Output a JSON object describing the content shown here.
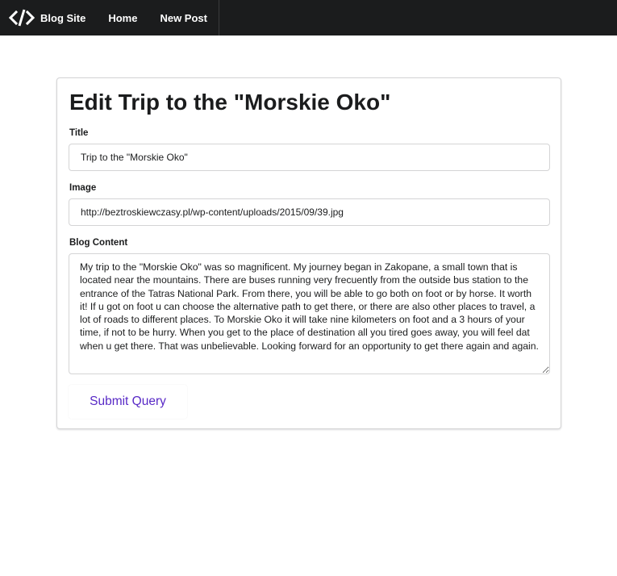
{
  "nav": {
    "brand_icon": "code-icon",
    "brand": "Blog Site",
    "home": "Home",
    "new_post": "New Post"
  },
  "page": {
    "title": "Edit Trip to the \"Morskie Oko\""
  },
  "form": {
    "title_label": "Title",
    "title_value": "Trip to the \"Morskie Oko\"",
    "image_label": "Image",
    "image_value": "http://beztroskiewczasy.pl/wp-content/uploads/2015/09/39.jpg",
    "content_label": "Blog Content",
    "content_value": "My trip to the \"Morskie Oko\" was so magnificent. My journey began in Zakopane, a small town that is located near the mountains. There are buses running very frecuently from the outside bus station to the entrance of the Tatras National Park. From there, you will be able to go both on foot or by horse. It worth it! If u got on foot u can choose the alternative path to get there, or there are also other places to travel, a lot of roads to different places. To Morskie Oko it will take nine kilometers on foot and a 3 hours of your time, if not to be hurry. When you get to the place of destination all you tired goes away, you will feel dat when u get there. That was unbelievable. Looking forward for an opportunity to get there again and again.",
    "submit_label": "Submit Query"
  },
  "colors": {
    "navbar_bg": "#1b1c1d",
    "submit_text": "#5829c6"
  }
}
